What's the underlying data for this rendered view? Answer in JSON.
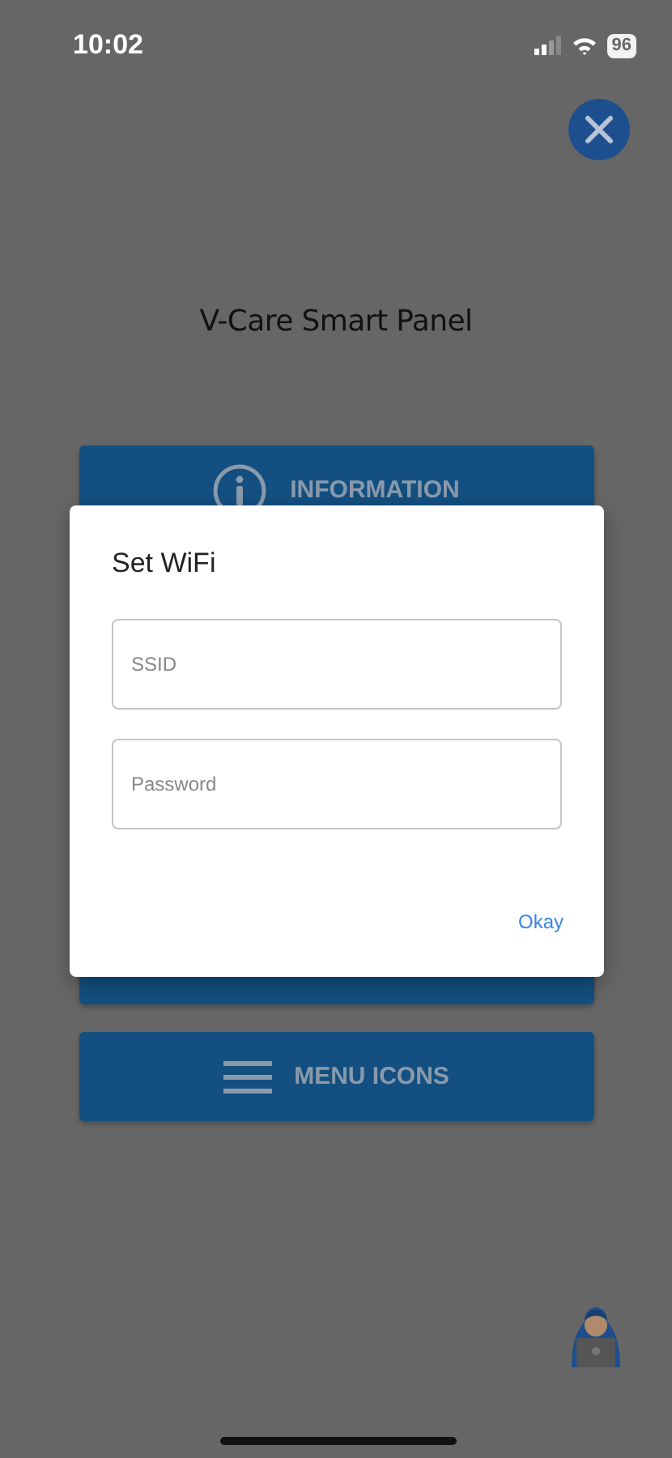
{
  "status_bar": {
    "time": "10:02",
    "battery": "96"
  },
  "title": "V-Care Smart Panel",
  "menu_buttons": [
    {
      "label": "INFORMATION",
      "kind": "info"
    },
    {
      "label": "MENU ICONS",
      "kind": "menu"
    }
  ],
  "dialog": {
    "title": "Set WiFi",
    "fields": [
      {
        "placeholder": "SSID"
      },
      {
        "placeholder": "Password"
      }
    ],
    "button": "Okay"
  }
}
